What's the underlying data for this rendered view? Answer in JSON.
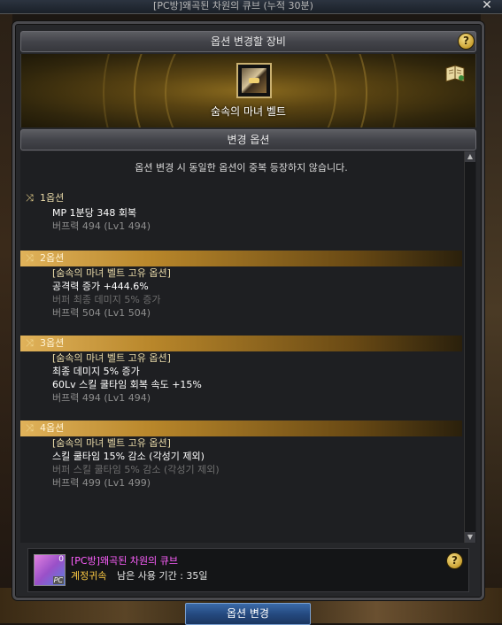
{
  "window": {
    "title": "[PC방]왜곡된 차원의 큐브 (누적 30분)",
    "close_glyph": "✕"
  },
  "equipment": {
    "header": "옵션 변경할 장비",
    "item_name": "숨속의 마녀 벨트",
    "help_glyph": "?"
  },
  "options": {
    "header": "변경 옵션",
    "notice": "옵션 변경 시 동일한 옵션이 중복 등장하지 않습니다.",
    "items": [
      {
        "label": "1옵션",
        "lines": [
          "MP 1분당 348 회복",
          "버프력 494 (Lv1 494)"
        ]
      },
      {
        "label": "2옵션",
        "lines": [
          "[숨속의 마녀 벨트 고유 옵션]",
          "공격력 증가 +444.6%",
          "버퍼 최종 데미지 5% 증가",
          "버프력 504 (Lv1 504)"
        ]
      },
      {
        "label": "3옵션",
        "lines": [
          "[숨속의 마녀 벨트 고유 옵션]",
          "최종 데미지 5% 증가",
          "60Lv 스킬 쿨타임 회복 속도 +15%",
          "버프력 494 (Lv1 494)"
        ]
      },
      {
        "label": "4옵션",
        "lines": [
          "[숨속의 마녀 벨트 고유 옵션]",
          "스킬 쿨타임 15% 감소 (각성기 제외)",
          "버퍼 스킬 쿨타임 5% 감소 (각성기 제외)",
          "버프력 499 (Lv1 499)"
        ]
      }
    ],
    "shuffle_glyph": "⤨"
  },
  "cube": {
    "name": "[PC방]왜곡된 차원의 큐브",
    "count": "0",
    "pc_badge": "PC",
    "bind": "계정귀속",
    "period": "남은 사용 기간 : 35일"
  },
  "actions": {
    "change_button": "옵션 변경"
  },
  "scroll": {
    "up_glyph": "▲",
    "down_glyph": "▼"
  }
}
